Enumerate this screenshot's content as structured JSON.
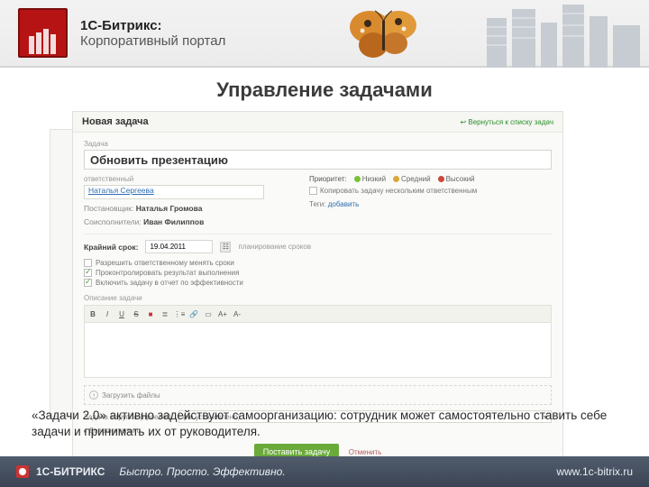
{
  "header": {
    "brand_line1": "1С-Битрикс:",
    "brand_line2": "Корпоративный портал"
  },
  "slide": {
    "title": "Управление задачами",
    "caption": "«Задачи 2.0» активно задействуют самоорганизацию: сотрудник может самостоятельно ставить себе задачи и принимать их от руководителя."
  },
  "panel": {
    "header_title": "Новая задача",
    "back_link": "Вернуться к списку задач",
    "task_label": "Задача",
    "task_title_value": "Обновить презентацию",
    "responsible_label": "ответственный",
    "responsible_value": "Наталья Сергеева",
    "creator_label": "Постановщик:",
    "creator_value": "Наталья Громова",
    "coexec_label": "Соисполнители:",
    "coexec_value": "Иван Филиппов",
    "priority_label": "Приоритет:",
    "priority_low": "Низкий",
    "priority_mid": "Средний",
    "priority_high": "Высокий",
    "dup_check": "Копировать задачу нескольким ответственным",
    "tags_label": "Теги:",
    "tags_add": "добавить",
    "deadline_label": "Крайний срок:",
    "deadline_value": "19.04.2011",
    "plan_link": "планирование сроков",
    "opt1": "Разрешить ответственному менять сроки",
    "opt2": "Проконтролировать результат выполнения",
    "opt3": "Включить задачу в отчет по эффективности",
    "desc_label": "Описание задачи",
    "upload_label": "Загрузить файлы",
    "group_label": "Задача в группе (проекте):",
    "group_value": "(не установлено)",
    "extra_link": "Дополнительно",
    "submit_label": "Поставить задачу",
    "cancel_label": "Отменить"
  },
  "footer": {
    "brand": "1С-БИТРИКС",
    "slogan": "Быстро. Просто. Эффективно.",
    "url": "www.1c-bitrix.ru"
  }
}
